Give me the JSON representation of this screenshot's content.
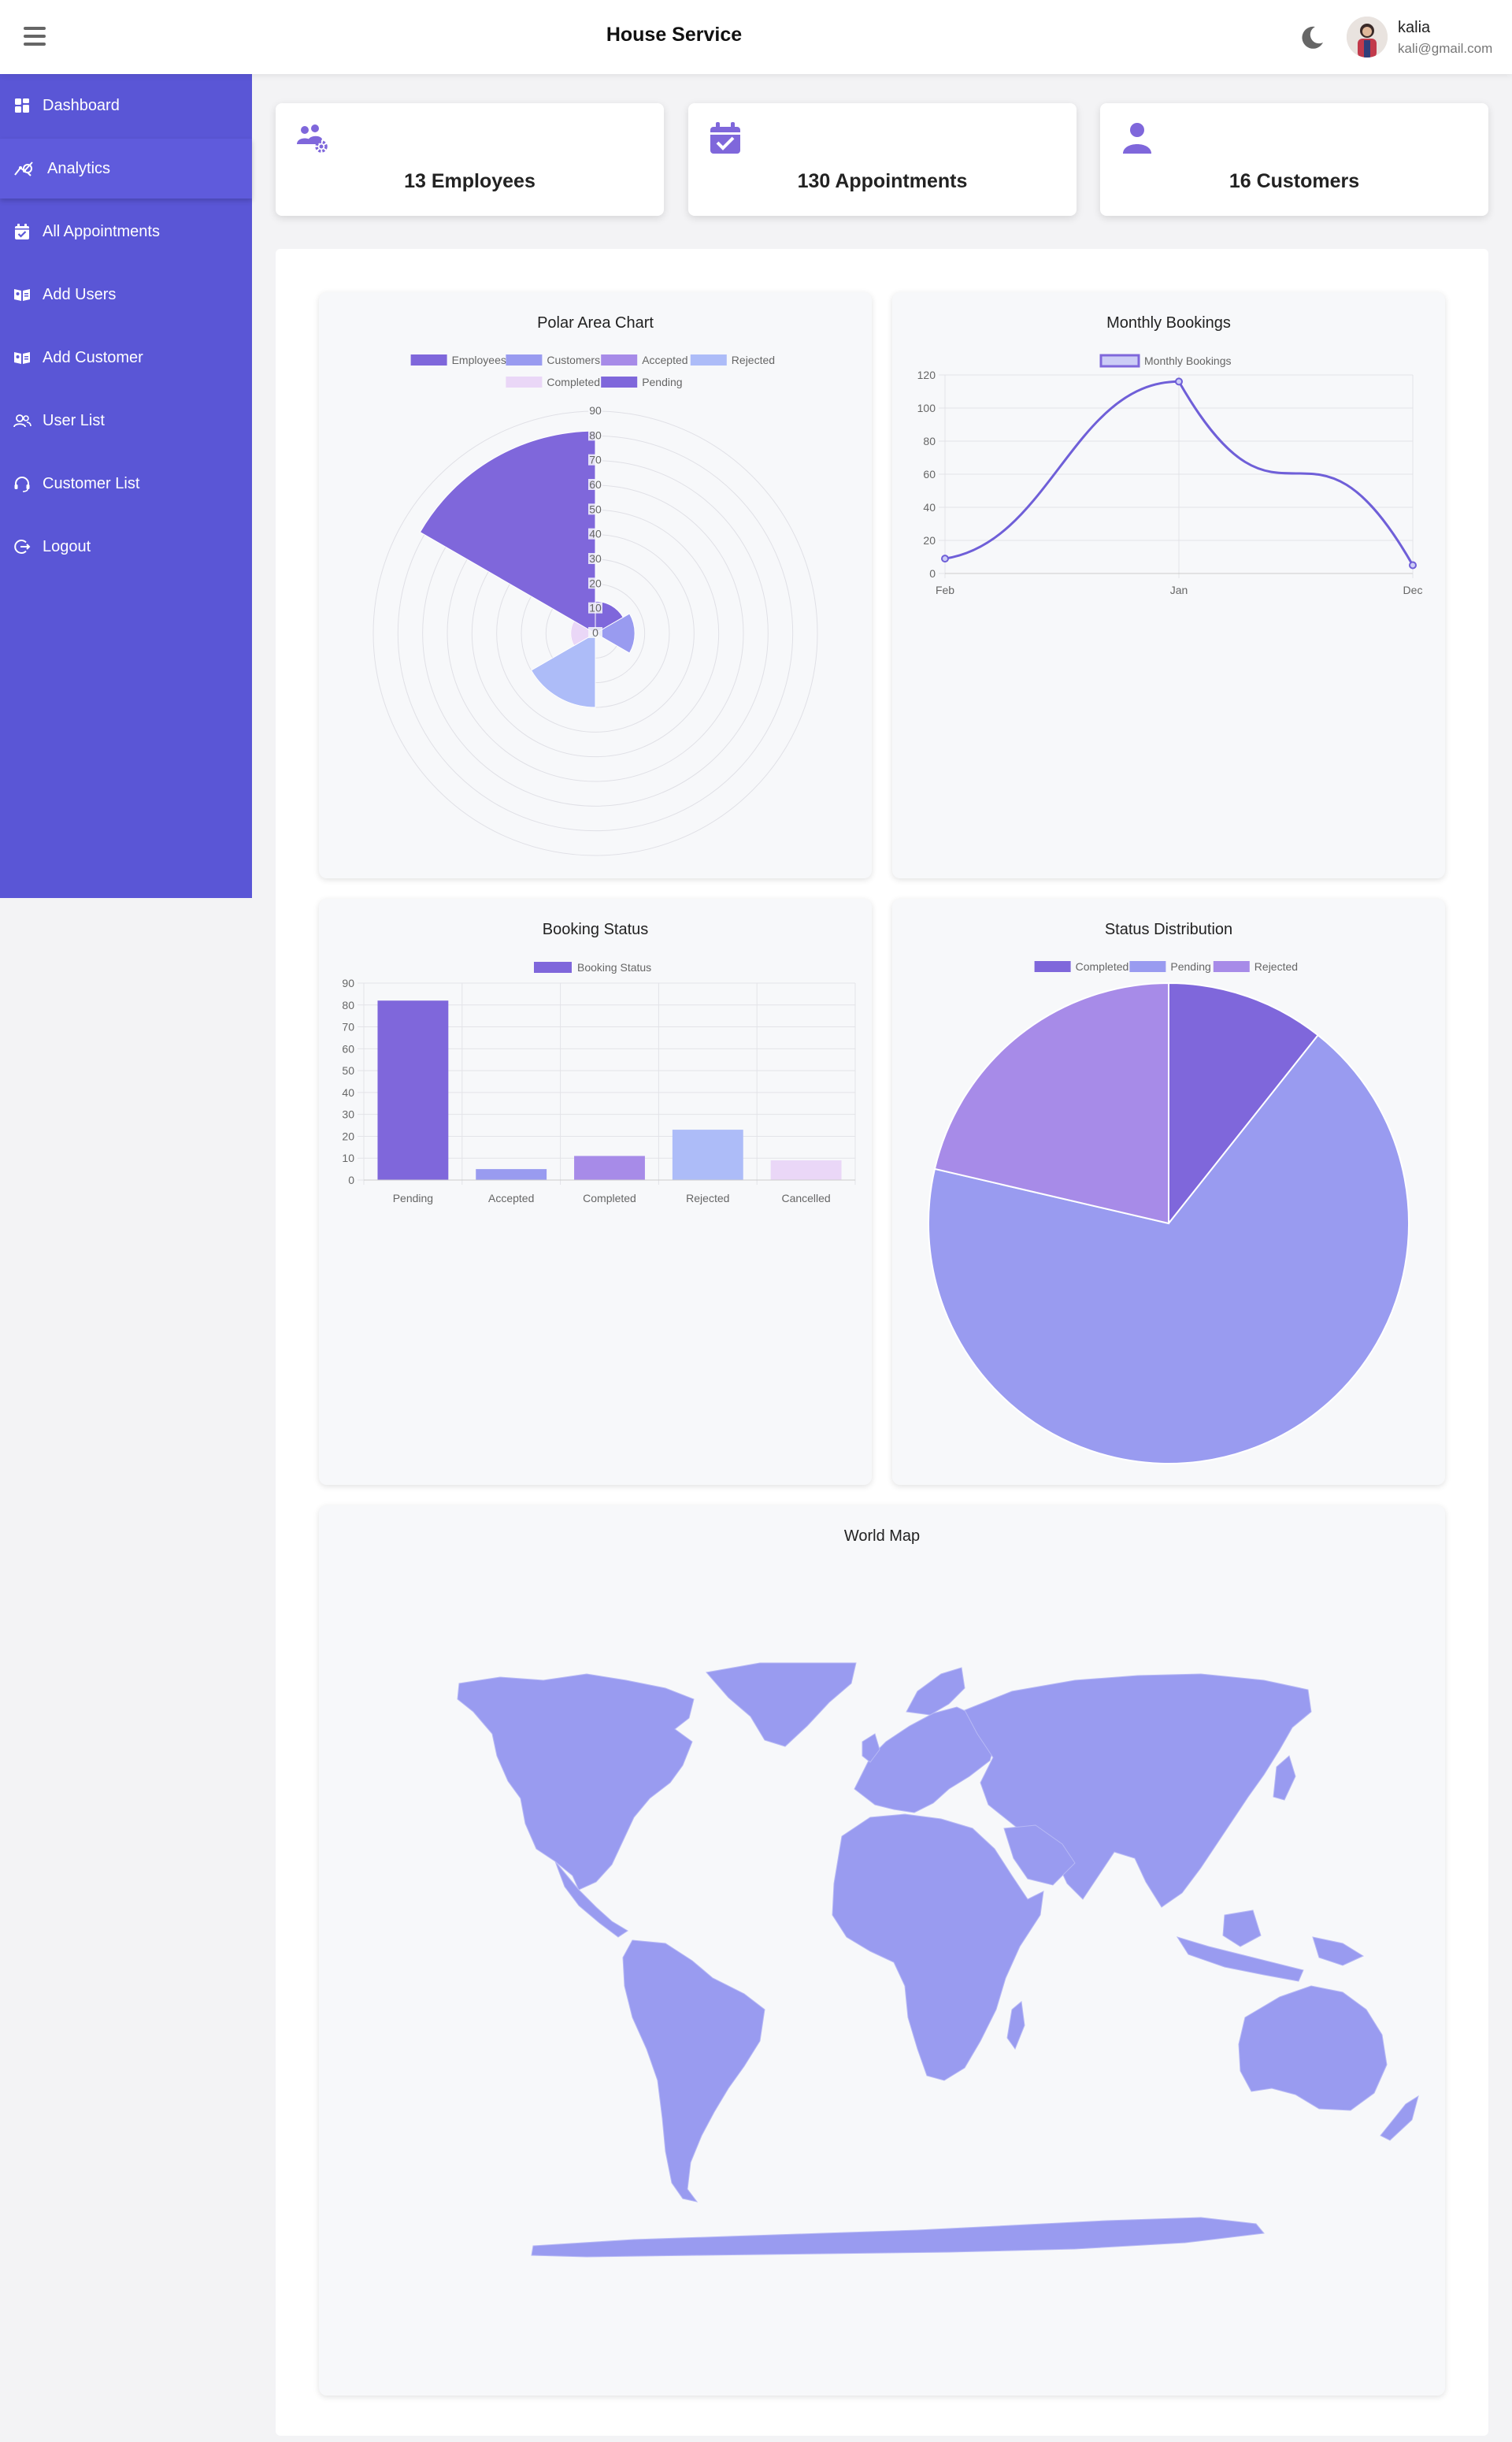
{
  "header": {
    "title": "House Service",
    "user_name": "kalia",
    "user_email": "kali@gmail.com"
  },
  "sidebar": {
    "items": [
      {
        "label": "Dashboard",
        "icon": "dashboard-icon"
      },
      {
        "label": "Analytics",
        "icon": "analytics-icon",
        "active": true
      },
      {
        "label": "All Appointments",
        "icon": "calendar-check-icon"
      },
      {
        "label": "Add Users",
        "icon": "id-card-icon"
      },
      {
        "label": "Add Customer",
        "icon": "id-card-icon"
      },
      {
        "label": "User List",
        "icon": "users-icon"
      },
      {
        "label": "Customer List",
        "icon": "headset-icon"
      },
      {
        "label": "Logout",
        "icon": "logout-icon"
      }
    ]
  },
  "stats": [
    {
      "label": "13 Employees",
      "icon": "users-gear-icon"
    },
    {
      "label": "130 Appointments",
      "icon": "calendar-check-icon"
    },
    {
      "label": "16 Customers",
      "icon": "user-icon"
    }
  ],
  "colors": {
    "sidebar": "#5a56d6",
    "accent": "#7f67db",
    "purple": "#7f67db",
    "periwinkle": "#999bf0",
    "lavender": "#a78be8",
    "light_blue": "#adbcf8",
    "pale_pink": "#ead7f7",
    "map": "#999bf0"
  },
  "charts": {
    "polar_title": "Polar Area Chart",
    "line_title": "Monthly Bookings",
    "bar_title": "Booking Status",
    "pie_title": "Status Distribution",
    "map_title": "World Map"
  },
  "chart_data": [
    {
      "type": "polar-area",
      "title": "Polar Area Chart",
      "categories": [
        "Employees",
        "Customers",
        "Accepted",
        "Rejected",
        "Completed",
        "Pending"
      ],
      "values": [
        13,
        16,
        0,
        30,
        10,
        82
      ],
      "colors": [
        "#7f67db",
        "#999bf0",
        "#a78be8",
        "#adbcf8",
        "#ead7f7",
        "#7f67db"
      ],
      "rlim": [
        0,
        90
      ],
      "ticks": [
        0,
        10,
        20,
        30,
        40,
        50,
        60,
        70,
        80,
        90
      ],
      "legend_position": "top"
    },
    {
      "type": "line",
      "title": "Monthly Bookings",
      "series": [
        {
          "name": "Monthly Bookings",
          "values": [
            9,
            116,
            5
          ]
        }
      ],
      "categories": [
        "Feb",
        "Jan",
        "Dec"
      ],
      "ylim": [
        0,
        120
      ],
      "yticks": [
        0,
        20,
        40,
        60,
        80,
        100,
        120
      ],
      "legend_position": "top",
      "grid": true
    },
    {
      "type": "bar",
      "title": "Booking Status",
      "series": [
        {
          "name": "Booking Status",
          "values": [
            82,
            5,
            11,
            23,
            9
          ]
        }
      ],
      "categories": [
        "Pending",
        "Accepted",
        "Completed",
        "Rejected",
        "Cancelled"
      ],
      "colors": [
        "#7f67db",
        "#999bf0",
        "#a78be8",
        "#adbcf8",
        "#ead7f7"
      ],
      "ylim": [
        0,
        90
      ],
      "yticks": [
        0,
        10,
        20,
        30,
        40,
        50,
        60,
        70,
        80,
        90
      ],
      "legend_position": "top",
      "grid": true
    },
    {
      "type": "pie",
      "title": "Status Distribution",
      "categories": [
        "Completed",
        "Pending",
        "Rejected"
      ],
      "values": [
        11,
        70,
        22
      ],
      "colors": [
        "#7f67db",
        "#999bf0",
        "#a78be8"
      ],
      "legend_position": "top"
    }
  ]
}
